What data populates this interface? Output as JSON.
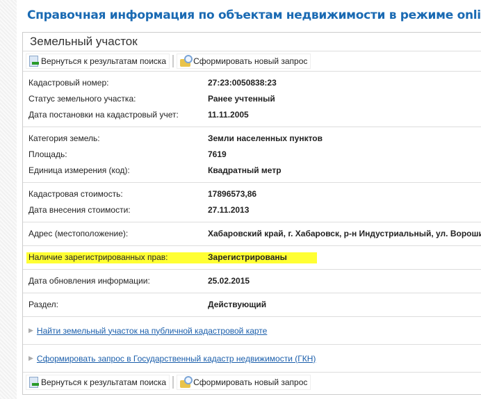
{
  "page_title": "Справочная информация по объектам недвижимости в режиме online",
  "panel_title": "Земельный участок",
  "toolbar": {
    "back_label": "Вернуться к результатам поиска",
    "new_query_label": "Сформировать новый запрос"
  },
  "groups": [
    [
      {
        "label": "Кадастровый номер:",
        "value": "27:23:0050838:23"
      },
      {
        "label": "Статус земельного участка:",
        "value": "Ранее учтенный"
      },
      {
        "label": "Дата постановки на кадастровый учет:",
        "value": "11.11.2005"
      }
    ],
    [
      {
        "label": "Категория земель:",
        "value": "Земли населенных пунктов"
      },
      {
        "label": "Площадь:",
        "value": "7619"
      },
      {
        "label": "Единица измерения (код):",
        "value": "Квадратный метр"
      }
    ],
    [
      {
        "label": "Кадастровая стоимость:",
        "value": "17896573,86"
      },
      {
        "label": "Дата внесения стоимости:",
        "value": "27.11.2013"
      }
    ],
    [
      {
        "label": "Адрес (местоположение):",
        "value": "Хабаровский край, г. Хабаровск, р-н Индустриальный, ул. Ворошилова"
      }
    ],
    [
      {
        "label": "Наличие зарегистрированных прав:",
        "value": "Зарегистрированы"
      }
    ],
    [
      {
        "label": "Дата обновления информации:",
        "value": "25.02.2015"
      }
    ],
    [
      {
        "label": "Раздел:",
        "value": "Действующий"
      }
    ]
  ],
  "links": [
    "Найти земельный участок на публичной кадастровой карте",
    "Сформировать запрос в Государственный кадастр недвижимости (ГКН)"
  ],
  "highlight_color": "#ffff33"
}
